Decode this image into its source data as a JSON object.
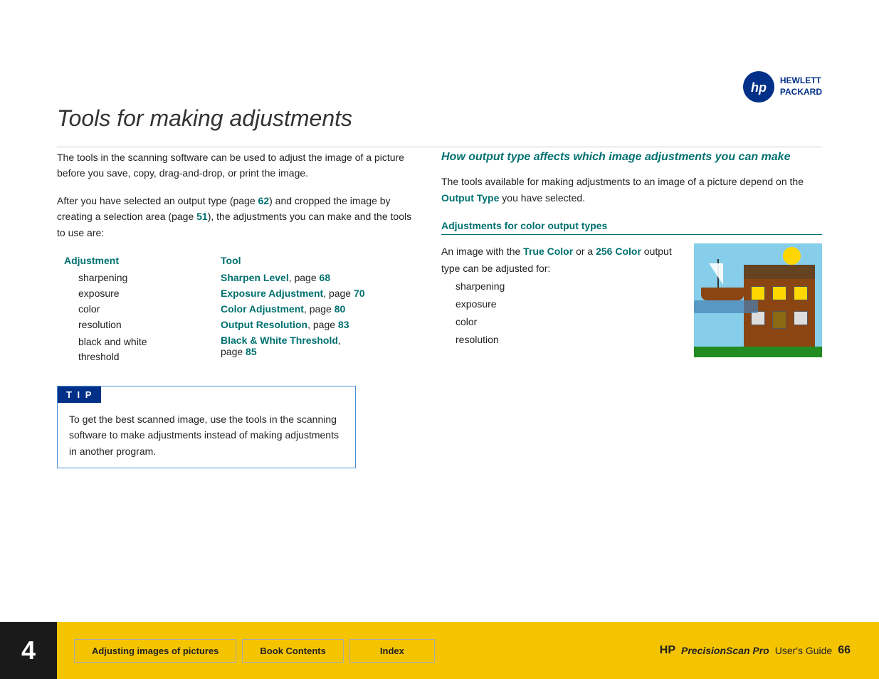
{
  "logo": {
    "symbol": "hp",
    "company_line1": "HEWLETT",
    "company_line2": "PACKARD"
  },
  "page_title": "Tools for making adjustments",
  "intro": {
    "para1": "The tools in the scanning software can be used to adjust the image of a picture before you save, copy, drag-and-drop, or print the image.",
    "para2_start": "After you have selected an output type (page ",
    "para2_link1": "62",
    "para2_middle": ") and cropped the image by creating a selection area (page ",
    "para2_link2": "51",
    "para2_end": "), the adjustments you can make and the tools to use are:"
  },
  "table": {
    "col1_header": "Adjustment",
    "col2_header": "Tool",
    "rows": [
      {
        "name": "sharpening",
        "tool_link": "Sharpen Level",
        "tool_suffix": ", page ",
        "page": "68"
      },
      {
        "name": "exposure",
        "tool_link": "Exposure Adjustment",
        "tool_suffix": ", page ",
        "page": "70"
      },
      {
        "name": "color",
        "tool_link": "Color Adjustment",
        "tool_suffix": ", page ",
        "page": "80"
      },
      {
        "name": "resolution",
        "tool_link": "Output Resolution",
        "tool_suffix": ", page ",
        "page": "83"
      },
      {
        "name": "black and white threshold",
        "tool_link": "Black & White Threshold",
        "tool_suffix": ", page ",
        "page": "85"
      }
    ]
  },
  "tip": {
    "header": "T I P",
    "content": "To get the best scanned image, use the tools in the scanning software to make adjustments instead of making adjustments in another program."
  },
  "right_section": {
    "title": "How output type affects which image adjustments you can make",
    "intro": "The tools available for making adjustments to an image of a picture depend on the ",
    "intro_link": "Output Type",
    "intro_end": " you have selected.",
    "color_section_title": "Adjustments for color output types",
    "color_intro_start": "An image with the ",
    "color_link1": "True Color",
    "color_middle": " or a ",
    "color_link2": "256 Color",
    "color_end": " output type can be adjusted for:",
    "color_items": [
      "sharpening",
      "exposure",
      "color",
      "resolution"
    ]
  },
  "footer": {
    "chapter_number": "4",
    "nav_items": [
      {
        "label": "Adjusting images of pictures"
      },
      {
        "label": "Book Contents"
      },
      {
        "label": "Index"
      }
    ],
    "brand": "HP",
    "product": "PrecisionScan Pro",
    "guide": "User's Guide",
    "page_number": "66"
  }
}
